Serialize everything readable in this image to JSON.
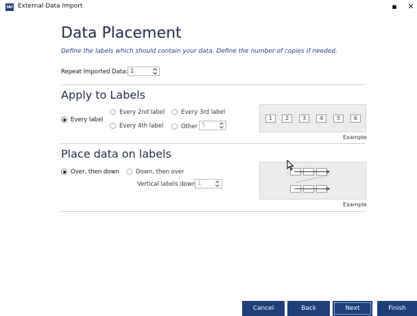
{
  "window": {
    "icon_text": "IAI",
    "title": "External Data Import",
    "maximize_glyph": "▪",
    "close_glyph": "✕"
  },
  "heading": "Data Placement",
  "subtitle": "Define the labels which should contain your data. Define the number of copies if needed.",
  "repeat": {
    "label": "Repeat Imported Data:",
    "value": "1"
  },
  "apply": {
    "title": "Apply to Labels",
    "options": {
      "every": "Every label",
      "every2": "Every 2nd label",
      "every3": "Every 3rd label",
      "every4": "Every 4th label",
      "other": "Other"
    },
    "other_value": "5",
    "selected": "every",
    "preview_numbers": [
      "1",
      "2",
      "3",
      "4",
      "5",
      "6"
    ],
    "example": "Example"
  },
  "place": {
    "title": "Place data on labels",
    "options": {
      "over_down": "Over, then down",
      "down_over": "Down, then over"
    },
    "selected": "over_down",
    "vertical_label": "Vertical labels down:",
    "vertical_value": "1",
    "example": "Example"
  },
  "buttons": {
    "cancel": "Cancel",
    "back": "Back",
    "next": "Next",
    "finish": "Finish"
  }
}
